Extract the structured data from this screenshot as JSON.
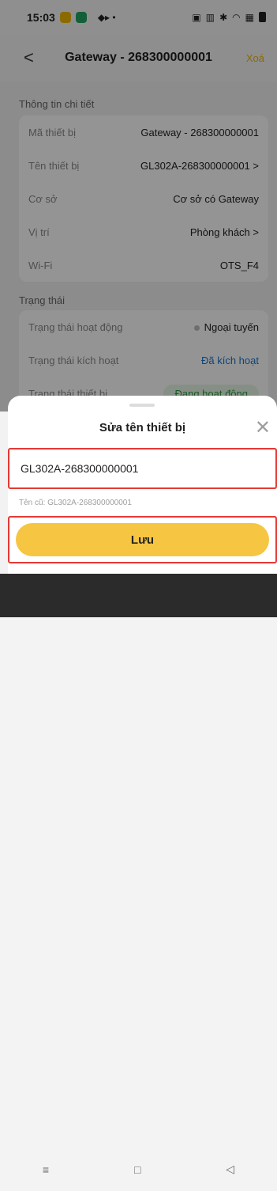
{
  "status": {
    "time": "15:03"
  },
  "header": {
    "back_icon": "chevron-left",
    "title": "Gateway - 268300000001",
    "delete_label": "Xoá"
  },
  "details": {
    "section_title": "Thông tin chi tiết",
    "rows": [
      {
        "label": "Mã thiết bị",
        "value": "Gateway - 268300000001"
      },
      {
        "label": "Tên thiết bị",
        "value": "GL302A-268300000001 >"
      },
      {
        "label": "Cơ sở",
        "value": "Cơ sở có Gateway"
      },
      {
        "label": "Vị trí",
        "value": "Phòng khách >"
      },
      {
        "label": "Wi-Fi",
        "value": "OTS_F4"
      }
    ]
  },
  "status_section": {
    "section_title": "Trạng thái",
    "rows": [
      {
        "label": "Trạng thái hoạt động",
        "value": "Ngoại tuyến"
      },
      {
        "label": "Trạng thái kích hoạt",
        "value": "Đã kích hoạt"
      },
      {
        "label": "Trạng thái thiết bị",
        "value": "Đang hoạt động"
      }
    ]
  },
  "sheet": {
    "title": "Sửa tên thiết bị",
    "input_value": "GL302A-268300000001",
    "old_name_text": "Tên cũ: GL302A-268300000001",
    "save_label": "Lưu"
  },
  "colors": {
    "accent": "#f6c541",
    "highlight": "#e53935",
    "link": "#1976d2"
  }
}
